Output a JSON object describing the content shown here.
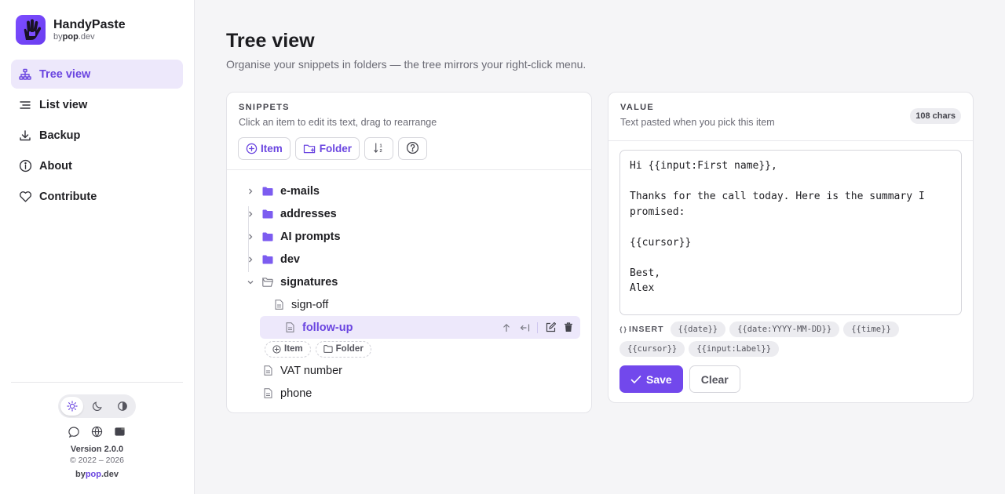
{
  "brand": {
    "name": "HandyPaste",
    "by": "by",
    "by_bold": "pop",
    "by_suffix": ".dev"
  },
  "nav": [
    {
      "label": "Tree view",
      "icon": "tree-icon",
      "active": true
    },
    {
      "label": "List view",
      "icon": "list-icon"
    },
    {
      "label": "Backup",
      "icon": "download-icon"
    },
    {
      "label": "About",
      "icon": "info-icon"
    },
    {
      "label": "Contribute",
      "icon": "heart-icon"
    }
  ],
  "footer": {
    "theme_options": [
      "light",
      "dark",
      "auto"
    ],
    "version": "Version 2.0.0",
    "copyright": "© 2022 – 2026",
    "by": "by",
    "by_pop": "pop",
    "by_dev": ".dev"
  },
  "page": {
    "title": "Tree view",
    "subtitle": "Organise your snippets in folders — the tree mirrors your right-click menu."
  },
  "snippets": {
    "label": "SNIPPETS",
    "desc": "Click an item to edit its text, drag to rearrange",
    "toolbar": {
      "item": "Item",
      "folder": "Folder"
    },
    "folders": [
      "e-mails",
      "addresses",
      "AI prompts",
      "dev"
    ],
    "open_folder": "signatures",
    "children": [
      "sign-off",
      "follow-up"
    ],
    "selected": "follow-up",
    "mini": {
      "item": "Item",
      "folder": "Folder"
    },
    "root_files": [
      "VAT number",
      "phone"
    ]
  },
  "value": {
    "label": "VALUE",
    "desc": "Text pasted when you pick this item",
    "chars": "108 chars",
    "text": "Hi {{input:First name}},\n\nThanks for the call today. Here is the summary I promised:\n\n{{cursor}}\n\nBest,\nAlex",
    "insert_label": "INSERT",
    "chips": [
      "{{date}}",
      "{{date:YYYY-MM-DD}}",
      "{{time}}",
      "{{cursor}}",
      "{{input:Label}}"
    ],
    "save": "Save",
    "clear": "Clear"
  },
  "colors": {
    "accent": "#7248ec",
    "accent_soft": "#ede8fb"
  }
}
